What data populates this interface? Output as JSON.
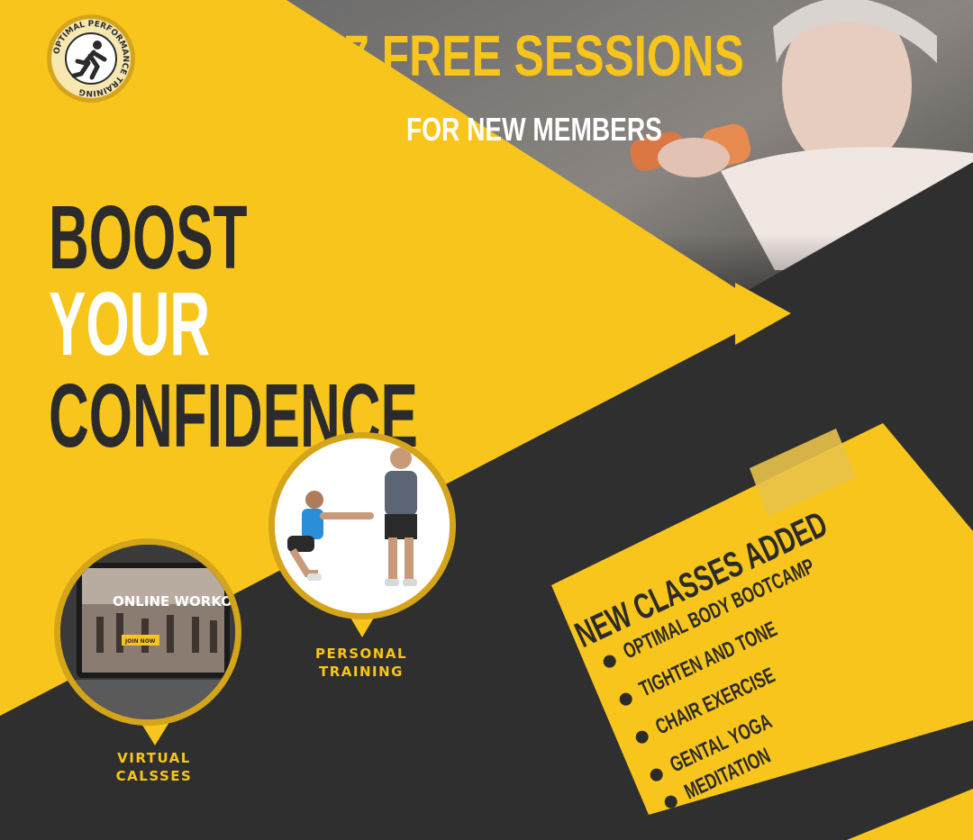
{
  "colors": {
    "yellow": "#f8c51c",
    "dark": "#2f2f2f",
    "gold": "#d4a51b",
    "white": "#ffffff"
  },
  "logo": {
    "text": "OPTIMAL PERFORMANCE TRAINING",
    "icon": "runner-icon"
  },
  "offer": {
    "title": "7 FREE SESSIONS",
    "subtitle": "FOR NEW MEMBERS"
  },
  "headline": {
    "line1": "BOOST",
    "line2": "YOUR",
    "line3": "CONFIDENCE"
  },
  "personal": {
    "caption_line1": "PERSONAL",
    "caption_line2": "TRAINING"
  },
  "virtual": {
    "caption_line1": "VIRTUAL",
    "caption_line2": "CALSSES",
    "screen_text": "ONLINE WORKOUTS",
    "button_text": "JOIN NOW"
  },
  "classes": {
    "title": "NEW CLASSES ADDED",
    "items": [
      "OPTIMAL BODY BOOTCAMP",
      "TIGHTEN AND TONE",
      "CHAIR EXERCISE",
      "GENTAL YOGA",
      "MEDITATION"
    ]
  }
}
